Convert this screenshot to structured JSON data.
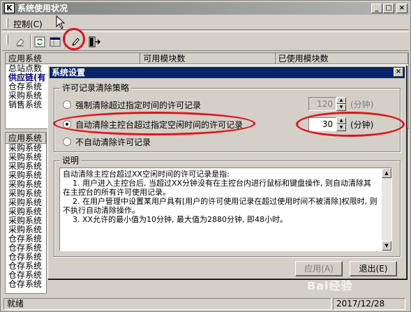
{
  "window": {
    "title": "系统使用状况",
    "app_icon": "app-icon",
    "controls": [
      "_",
      "□",
      "×"
    ]
  },
  "menu": {
    "control_label": "控制(C)"
  },
  "toolbar": {
    "icons": [
      "eraser-icon",
      "refresh-icon",
      "grid-icon",
      "pencil-icon",
      "exit-icon"
    ]
  },
  "bg_table": {
    "headers": [
      "应用系统",
      "可用模块数",
      "已使用模块数"
    ],
    "rows": [
      "总站点数",
      "供应链(有",
      "仓存系统",
      "采购系统",
      "销售系统"
    ]
  },
  "bg_table2": {
    "header": "应用系统",
    "rows": [
      "采购系统",
      "采购系统",
      "采购系统",
      "采购系统",
      "采购系统",
      "采购系统",
      "采购系统",
      "采购系统",
      "采购系统",
      "采购系统",
      "仓存系统",
      "仓存系统",
      "仓存系统",
      "仓存系统",
      "仓存系统",
      "仓存系统"
    ]
  },
  "status": {
    "left": "就绪",
    "date": "2017/12/28"
  },
  "dialog": {
    "title": "系统设置",
    "close": "×",
    "policy_group_label": "许可记录清除策略",
    "options": [
      {
        "label": "强制清除超过指定时间的许可记录",
        "checked": false
      },
      {
        "label": "自动清除主控台超过指定空闲时间的许可记录",
        "checked": true
      },
      {
        "label": "不自动清除许可记录",
        "checked": false
      }
    ],
    "force_minutes": "120",
    "force_unit": "(分钟)",
    "auto_minutes": "30",
    "auto_unit": "(分钟)",
    "explain_label": "说明",
    "explain_lines": [
      "自动清除主控台超过XX空闲时间的许可记录是指:",
      "    1. 用户进入主控台后, 当超过XX分钟没有在主控台内进行鼠标和键盘操作, 则自动清除其在主控台的所有许可使用记录。",
      "    2. 在用户管理中设置某用户具有[用户的许可使用记录在超过使用时间不被清除]权限时, 则不执行自动清除操作。",
      "    3. XX允许的最小值为10分钟, 最大值为2880分钟, 即48小时。"
    ],
    "apply_label": "应用(A)",
    "exit_label": "退出(E)"
  },
  "watermark": "Bai经验"
}
